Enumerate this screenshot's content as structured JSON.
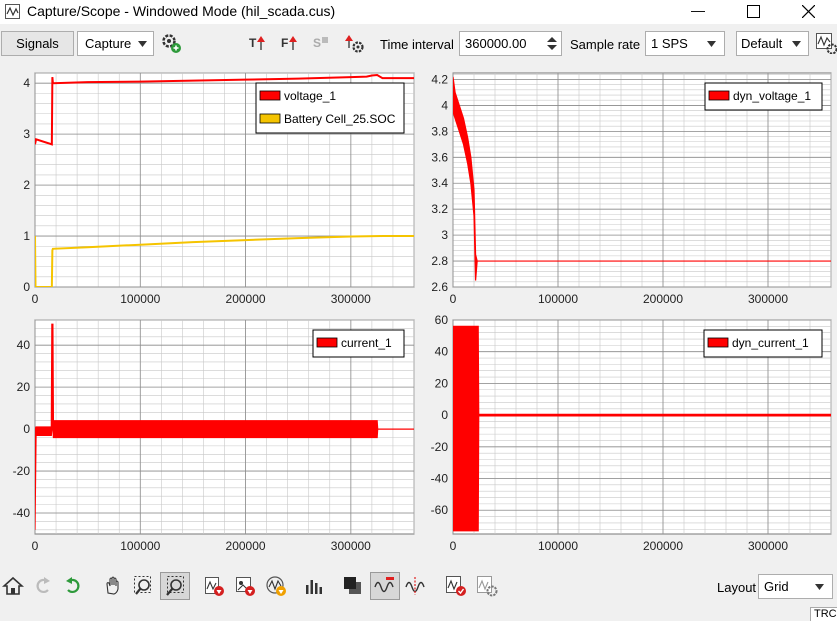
{
  "window": {
    "title": "Capture/Scope - Windowed Mode (hil_scada.cus)",
    "minimize_label": "—",
    "maximize_label": "☐",
    "close_label": "✕"
  },
  "toolbar": {
    "signals_label": "Signals",
    "capture_select": "Capture",
    "time_interval_label": "Time interval",
    "time_interval_value": "360000.00",
    "sample_rate_label": "Sample rate",
    "sample_rate_value": "1 SPS",
    "preset_value": "Default",
    "trigger_icons": [
      "T",
      "F",
      "S"
    ]
  },
  "bottom": {
    "layout_label": "Layout",
    "layout_value": "Grid",
    "status_text": "TRC"
  },
  "colors": {
    "red": "#ff0000",
    "yellow": "#f5c400",
    "grid": "#c8c8c8",
    "gridMajor": "#8c8c8c",
    "icon_green": "#2e9a3b"
  },
  "icons": {
    "toolbar": [
      "trigger-rising-icon",
      "trigger-falling-icon",
      "trigger-single-icon",
      "trigger-settings-icon",
      "capture-settings-icon",
      "export-icon"
    ],
    "bottom": [
      "home-icon",
      "undo-icon",
      "redo-icon",
      "pan-icon",
      "zoom-rect-icon",
      "zoom-auto-icon",
      "import-icon",
      "delete-icon",
      "add-signal-icon",
      "bar-chart-icon",
      "stack-icon",
      "analog-wave-icon",
      "fft-icon",
      "remove-plot-icon",
      "plot-settings-icon"
    ]
  },
  "chart_data": [
    {
      "type": "line",
      "xlim": [
        0,
        360000
      ],
      "ylim": [
        0,
        4.2
      ],
      "xticks": [
        0,
        100000,
        200000,
        300000
      ],
      "yticks": [
        0,
        1,
        2,
        3,
        4
      ],
      "x_tick_labels": [
        "0",
        "100000",
        "200000",
        "300000"
      ],
      "y_tick_labels": [
        "0",
        "1",
        "2",
        "3",
        "4"
      ],
      "legend": "top-right",
      "series": [
        {
          "name": "voltage_1",
          "color": "#ff0000",
          "x": [
            0,
            1000,
            16000,
            16500,
            17000,
            50000,
            100000,
            150000,
            200000,
            250000,
            300000,
            315000,
            320000,
            325000,
            330000,
            360000
          ],
          "y": [
            2.8,
            2.9,
            2.8,
            4.12,
            4.0,
            4.02,
            4.03,
            4.05,
            4.07,
            4.09,
            4.12,
            4.13,
            4.15,
            4.16,
            4.1,
            4.1
          ]
        },
        {
          "name": "Battery Cell_25.SOC",
          "color": "#f5c400",
          "x": [
            0,
            500,
            1000,
            16000,
            16500,
            17000,
            50000,
            100000,
            150000,
            200000,
            250000,
            300000,
            330000,
            360000
          ],
          "y": [
            1.0,
            0.0,
            0.0,
            0.0,
            0.72,
            0.75,
            0.78,
            0.83,
            0.88,
            0.92,
            0.96,
            0.99,
            1.0,
            1.0
          ]
        }
      ]
    },
    {
      "type": "line",
      "xlim": [
        0,
        360000
      ],
      "ylim": [
        2.6,
        4.25
      ],
      "xticks": [
        0,
        100000,
        200000,
        300000
      ],
      "yticks": [
        2.6,
        2.8,
        3,
        3.2,
        3.4,
        3.6,
        3.8,
        4,
        4.2
      ],
      "x_tick_labels": [
        "0",
        "100000",
        "200000",
        "300000"
      ],
      "y_tick_labels": [
        "2.6",
        "2.8",
        "3",
        "3.2",
        "3.4",
        "3.6",
        "3.8",
        "4",
        "4.2"
      ],
      "legend": "top-right",
      "series": [
        {
          "name": "dyn_voltage_1",
          "color": "#ff0000",
          "upper_x": [
            0,
            2000,
            6000,
            10000,
            14000,
            17000,
            20000,
            21500,
            23000,
            360000
          ],
          "upper_y": [
            4.22,
            4.1,
            4.0,
            3.9,
            3.75,
            3.6,
            3.35,
            2.85,
            2.8,
            2.8
          ],
          "lower_x": [
            0,
            2000,
            6000,
            10000,
            14000,
            17000,
            20000,
            21500,
            23000,
            360000
          ],
          "lower_y": [
            3.95,
            3.9,
            3.8,
            3.7,
            3.55,
            3.4,
            3.15,
            2.65,
            2.8,
            2.8
          ]
        }
      ]
    },
    {
      "type": "line",
      "xlim": [
        0,
        360000
      ],
      "ylim": [
        -50,
        52
      ],
      "xticks": [
        0,
        100000,
        200000,
        300000
      ],
      "yticks": [
        -40,
        -20,
        0,
        20,
        40
      ],
      "x_tick_labels": [
        "0",
        "100000",
        "200000",
        "300000"
      ],
      "y_tick_labels": [
        "-40",
        "-20",
        "0",
        "20",
        "40"
      ],
      "legend": "top-right",
      "series": [
        {
          "name": "current_1",
          "color": "#ff0000",
          "upper_x": [
            0,
            1000,
            15500,
            16000,
            17000,
            17500,
            325000,
            325500,
            360000
          ],
          "upper_y": [
            0,
            1,
            1,
            50,
            50,
            4,
            4,
            0,
            0
          ],
          "lower_x": [
            0,
            1000,
            15500,
            16000,
            17000,
            17500,
            325000,
            325500,
            360000
          ],
          "lower_y": [
            -48,
            -3,
            -3,
            0,
            0,
            -4,
            -4,
            0,
            0
          ]
        }
      ]
    },
    {
      "type": "line",
      "xlim": [
        0,
        360000
      ],
      "ylim": [
        -75,
        60
      ],
      "xticks": [
        0,
        100000,
        200000,
        300000
      ],
      "yticks": [
        -60,
        -40,
        -20,
        0,
        20,
        40,
        60
      ],
      "x_tick_labels": [
        "0",
        "100000",
        "200000",
        "300000"
      ],
      "y_tick_labels": [
        "-60",
        "-40",
        "-20",
        "0",
        "20",
        "40",
        "60"
      ],
      "legend": "top-right",
      "series": [
        {
          "name": "dyn_current_1",
          "color": "#ff0000",
          "upper_x": [
            0,
            24000,
            24500,
            360000
          ],
          "upper_y": [
            56,
            56,
            0.5,
            0.5
          ],
          "lower_x": [
            0,
            24000,
            24500,
            360000
          ],
          "lower_y": [
            -73,
            -73,
            -0.5,
            -0.5
          ]
        }
      ]
    }
  ]
}
